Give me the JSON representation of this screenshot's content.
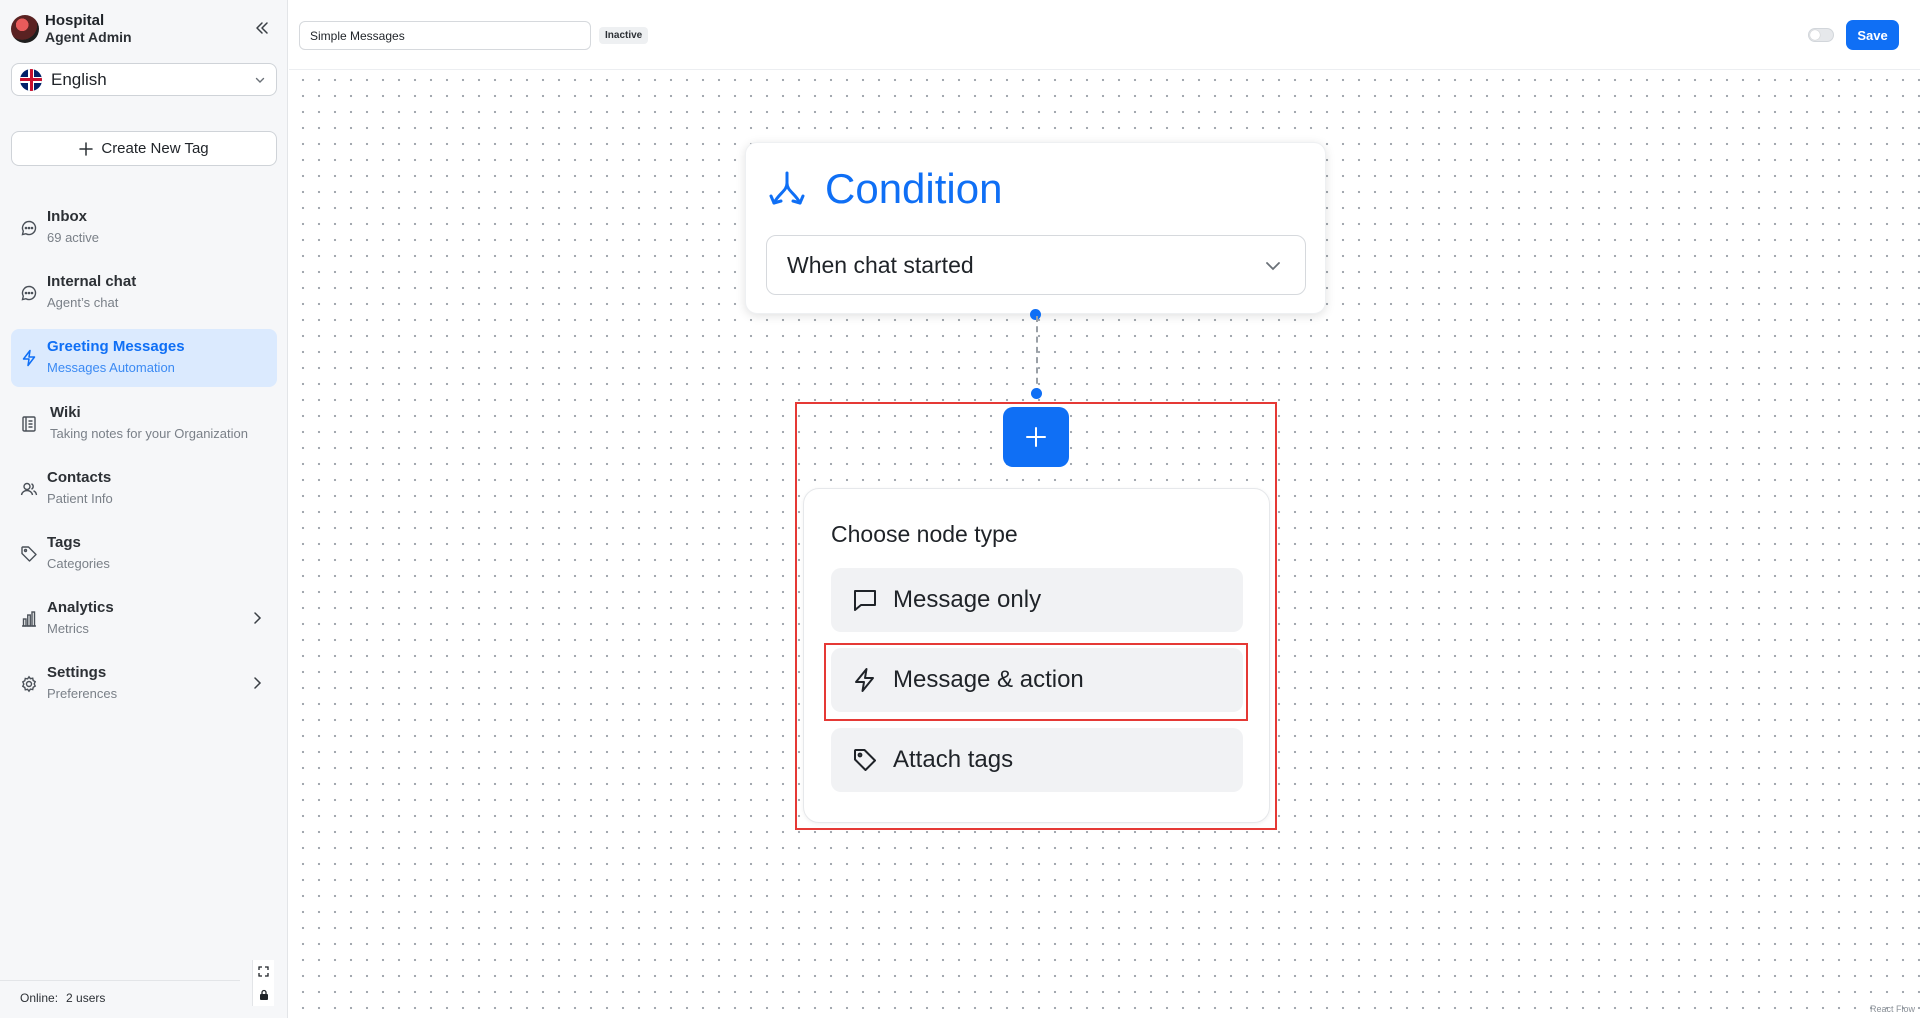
{
  "brand": {
    "org": "Hospital",
    "role": "Agent Admin"
  },
  "language": {
    "selected": "English"
  },
  "create_tag": {
    "label": "Create New Tag"
  },
  "nav": {
    "items": [
      {
        "title": "Inbox",
        "subtitle": "69 active"
      },
      {
        "title": "Internal chat",
        "subtitle": "Agent’s chat"
      },
      {
        "title": "Greeting Messages",
        "subtitle": "Messages Automation"
      },
      {
        "title": "Wiki",
        "subtitle": "Taking notes for your Organization"
      },
      {
        "title": "Contacts",
        "subtitle": "Patient Info"
      },
      {
        "title": "Tags",
        "subtitle": "Categories"
      },
      {
        "title": "Analytics",
        "subtitle": "Metrics"
      },
      {
        "title": "Settings",
        "subtitle": "Preferences"
      }
    ],
    "active": "Greeting Messages"
  },
  "online": {
    "label": "Online:",
    "value": "2 users"
  },
  "topbar": {
    "flow_name": "Simple Messages",
    "status": "Inactive",
    "toggle_on": false,
    "save_label": "Save"
  },
  "canvas": {
    "condition": {
      "title": "Condition",
      "selected_trigger": "When chat started"
    },
    "node_menu": {
      "title": "Choose node type",
      "options": [
        {
          "label": "Message only",
          "icon": "message-square-icon"
        },
        {
          "label": "Message & action",
          "icon": "lightning-icon"
        },
        {
          "label": "Attach tags",
          "icon": "tag-icon"
        }
      ],
      "highlighted": "Message & action"
    },
    "attribution": "React Flow"
  },
  "colors": {
    "accent": "#0f6ff5",
    "active_nav_bg": "#dbeafe",
    "highlight": "#e53935"
  }
}
